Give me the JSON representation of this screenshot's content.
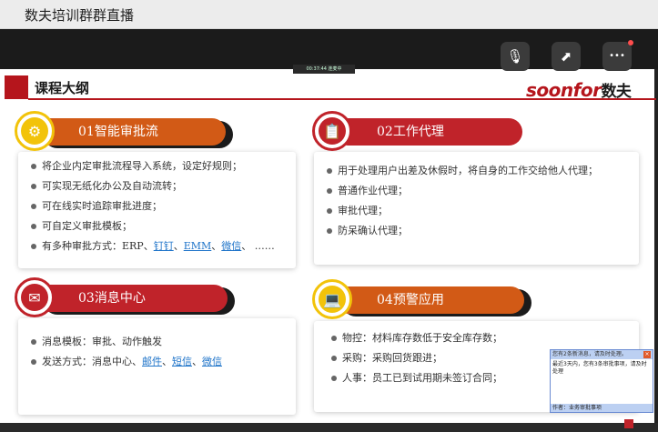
{
  "window": {
    "title": "数夫培训群群直播"
  },
  "video": {
    "rec_text": "00:37:44 连麦中"
  },
  "controls": [
    {
      "name": "voice-icon",
      "glyph": "🎙"
    },
    {
      "name": "share-icon",
      "glyph": "⬈"
    },
    {
      "name": "more-icon",
      "glyph": "•••"
    }
  ],
  "slide": {
    "header": "课程大纲",
    "logo": {
      "text": "soonfor",
      "cn": "数夫"
    },
    "sections": [
      {
        "title": "01智能审批流",
        "icon": "gear-icon",
        "items": [
          "将企业内定审批流程导入系统，设定好规则；",
          "可实现无纸化办公及自动流转；",
          "可在线实时追踪审批进度；",
          "可自定义审批模板；"
        ],
        "last_item": {
          "prefix": "有多种审批方式：ERP、",
          "links": [
            "钉钉",
            "EMM",
            "微信"
          ],
          "suffix": "……"
        }
      },
      {
        "title": "02工作代理",
        "icon": "clipboard-icon",
        "items": [
          "用于处理用户出差及休假时，将自身的工作交给他人代理；",
          "普通作业代理；",
          "审批代理；",
          "防呆确认代理；"
        ]
      },
      {
        "title": "03消息中心",
        "icon": "message-icon",
        "items": [
          "消息模板：审批、动作触发"
        ],
        "last_item": {
          "prefix": "发送方式：消息中心、",
          "links": [
            "邮件",
            "短信",
            "微信"
          ],
          "suffix": ""
        }
      },
      {
        "title": "04预警应用",
        "icon": "laptop-icon",
        "items": [
          "物控：材料库存数低于安全库存数；",
          "采购：采购回货跟进；",
          "人事：员工已到试用期未签订合同；"
        ]
      }
    ]
  },
  "popup": {
    "header": "您有2条新消息，请及时处理。",
    "body": "最近3天内，您有3条审批事项，请及时处理",
    "footer": "作者：业务审批事项"
  }
}
